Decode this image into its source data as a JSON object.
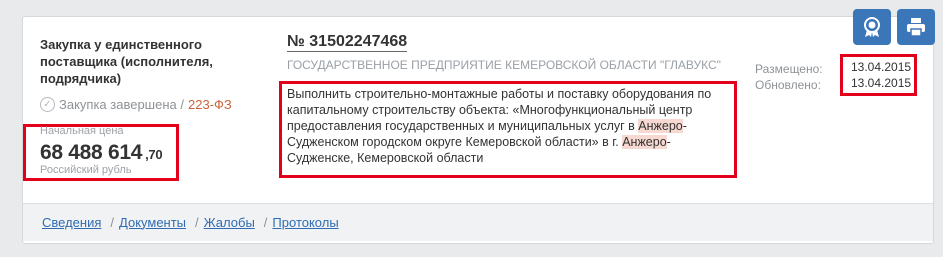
{
  "purchase": {
    "type": "Закупка у единственного поставщика (исполнителя, подрядчика)",
    "status": "Закупка завершена",
    "law": "223-ФЗ",
    "price_label": "Начальная цена",
    "price_value": "68 488 614",
    "price_kopecks": ",70",
    "currency": "Российский рубль",
    "reg_number": "№ 31502247468",
    "customer": "ГОСУДАРСТВЕННОЕ ПРЕДПРИЯТИЕ КЕМЕРОВСКОЙ ОБЛАСТИ \"ГЛАВУКС\"",
    "subject": {
      "part1": "Выполнить строительно-монтажные работы и поставку оборудования по капитальному строительству объекта: «Многофункциональный центр предоставления государственных и муниципальных услуг в ",
      "hl1": "Анжеро",
      "part2": "-Судженском городском округе Кемеровской области» в г. ",
      "hl2": "Анжеро",
      "part3": "-Судженске, Кемеровской области"
    },
    "dates": {
      "published_label": "Размещено:",
      "updated_label": "Обновлено:",
      "published": "13.04.2015",
      "updated": "13.04.2015"
    }
  },
  "tabs": [
    "Сведения",
    "Документы",
    "Жалобы",
    "Протоколы"
  ],
  "icons": {
    "status": "check-circle-icon",
    "award": "award-icon",
    "print": "printer-icon"
  },
  "colors": {
    "accent": "#3b77b8",
    "highlight_border": "#e3001b",
    "law": "#c8643a",
    "link": "#2f6cb3"
  }
}
